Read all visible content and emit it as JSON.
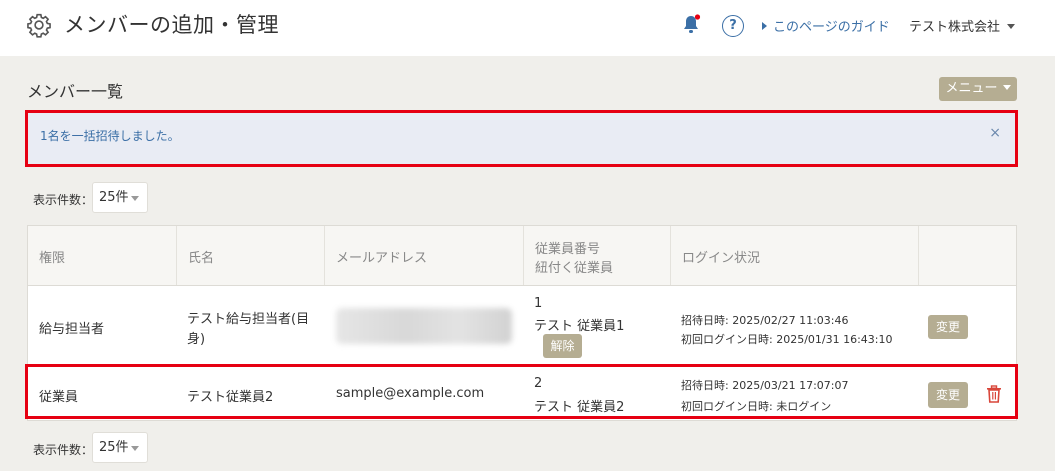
{
  "header": {
    "title": "メンバーの追加・管理",
    "guide_link": "このページのガイド",
    "company": "テスト株式会社",
    "help_symbol": "?"
  },
  "section": {
    "title": "メンバー一覧",
    "menu_button": "メニュー"
  },
  "alert": {
    "message": "1名を一括招待しました。",
    "close_symbol": "×"
  },
  "pagination": {
    "label": "表示件数：",
    "value": "25件"
  },
  "table": {
    "headers": {
      "role": "権限",
      "name": "氏名",
      "email": "メールアドレス",
      "employee_no": "従業員番号",
      "linked_employee": "紐付く従業員",
      "login_status": "ログイン状況"
    },
    "rows": [
      {
        "role": "給与担当者",
        "name_line1": "テスト給与担当者(目",
        "name_line2": "身)",
        "email": "",
        "employee_no": "1",
        "employee_name": "テスト 従業員1",
        "unlink_button": "解除",
        "invited": "招待日時: 2025/02/27 11:03:46",
        "first_login": "初回ログイン日時: 2025/01/31 16:43:10",
        "change_button": "変更"
      },
      {
        "role": "従業員",
        "name_line1": "テスト従業員2",
        "email": "sample@example.com",
        "employee_no": "2",
        "employee_name": "テスト 従業員2",
        "invited": "招待日時: 2025/03/21 17:07:07",
        "first_login": "初回ログイン日時: 未ログイン",
        "change_button": "変更"
      }
    ]
  },
  "colors": {
    "accent_red": "#e60012",
    "link_blue": "#3b6fa6",
    "button_beige": "#b5ad92",
    "background": "#f0efeb"
  }
}
